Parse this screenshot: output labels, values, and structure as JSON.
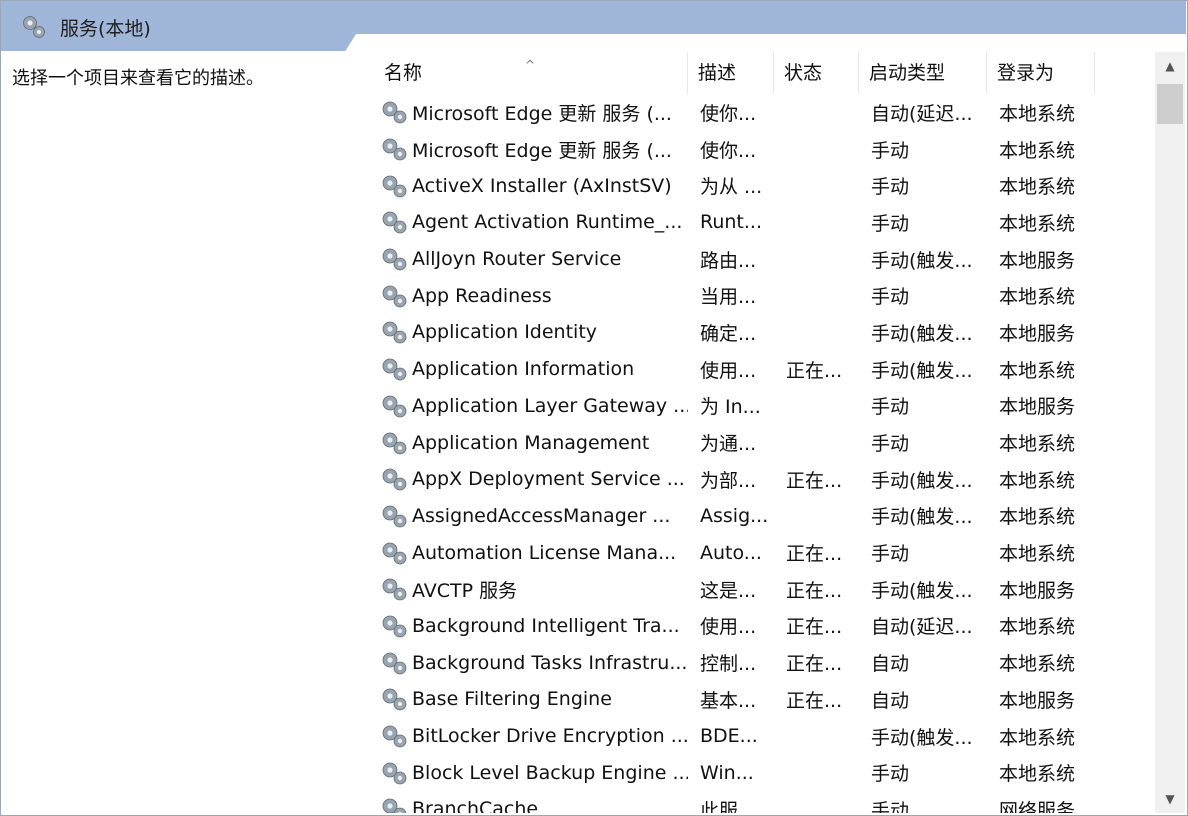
{
  "window": {
    "title": "服务(本地)",
    "title_icon": "services-gear-icon"
  },
  "left_pane": {
    "hint": "选择一个项目来查看它的描述。"
  },
  "table": {
    "columns": {
      "name": "名称",
      "description": "描述",
      "status": "状态",
      "startup_type": "启动类型",
      "log_on_as": "登录为"
    },
    "sort_indicator": "^",
    "rows": [
      {
        "name": "Microsoft Edge 更新 服务 (...",
        "description": "使你...",
        "status": "",
        "startup_type": "自动(延迟...",
        "log_on_as": "本地系统"
      },
      {
        "name": "Microsoft Edge 更新 服务 (...",
        "description": "使你...",
        "status": "",
        "startup_type": "手动",
        "log_on_as": "本地系统"
      },
      {
        "name": "ActiveX Installer (AxInstSV)",
        "description": "为从 ...",
        "status": "",
        "startup_type": "手动",
        "log_on_as": "本地系统"
      },
      {
        "name": "Agent Activation Runtime_...",
        "description": "Runt...",
        "status": "",
        "startup_type": "手动",
        "log_on_as": "本地系统"
      },
      {
        "name": "AllJoyn Router Service",
        "description": "路由...",
        "status": "",
        "startup_type": "手动(触发...",
        "log_on_as": "本地服务"
      },
      {
        "name": "App Readiness",
        "description": "当用...",
        "status": "",
        "startup_type": "手动",
        "log_on_as": "本地系统"
      },
      {
        "name": "Application Identity",
        "description": "确定...",
        "status": "",
        "startup_type": "手动(触发...",
        "log_on_as": "本地服务"
      },
      {
        "name": "Application Information",
        "description": "使用...",
        "status": "正在...",
        "startup_type": "手动(触发...",
        "log_on_as": "本地系统"
      },
      {
        "name": "Application Layer Gateway ...",
        "description": "为 In...",
        "status": "",
        "startup_type": "手动",
        "log_on_as": "本地服务"
      },
      {
        "name": "Application Management",
        "description": "为通...",
        "status": "",
        "startup_type": "手动",
        "log_on_as": "本地系统"
      },
      {
        "name": "AppX Deployment Service ...",
        "description": "为部...",
        "status": "正在...",
        "startup_type": "手动(触发...",
        "log_on_as": "本地系统"
      },
      {
        "name": "AssignedAccessManager ...",
        "description": "Assig...",
        "status": "",
        "startup_type": "手动(触发...",
        "log_on_as": "本地系统"
      },
      {
        "name": "Automation License Mana...",
        "description": "Auto...",
        "status": "正在...",
        "startup_type": "手动",
        "log_on_as": "本地系统"
      },
      {
        "name": "AVCTP 服务",
        "description": "这是...",
        "status": "正在...",
        "startup_type": "手动(触发...",
        "log_on_as": "本地服务"
      },
      {
        "name": "Background Intelligent Tra...",
        "description": "使用...",
        "status": "正在...",
        "startup_type": "自动(延迟...",
        "log_on_as": "本地系统"
      },
      {
        "name": "Background Tasks Infrastru...",
        "description": "控制...",
        "status": "正在...",
        "startup_type": "自动",
        "log_on_as": "本地系统"
      },
      {
        "name": "Base Filtering Engine",
        "description": "基本...",
        "status": "正在...",
        "startup_type": "自动",
        "log_on_as": "本地服务"
      },
      {
        "name": "BitLocker Drive Encryption ...",
        "description": "BDE...",
        "status": "",
        "startup_type": "手动(触发...",
        "log_on_as": "本地系统"
      },
      {
        "name": "Block Level Backup Engine ...",
        "description": "Win...",
        "status": "",
        "startup_type": "手动",
        "log_on_as": "本地系统"
      },
      {
        "name": "BranchCache",
        "description": "此服...",
        "status": "",
        "startup_type": "手动",
        "log_on_as": "网络服务"
      }
    ]
  },
  "scrollbar": {
    "up_icon": "scroll-up-arrow-icon",
    "down_icon": "scroll-down-arrow-icon"
  }
}
